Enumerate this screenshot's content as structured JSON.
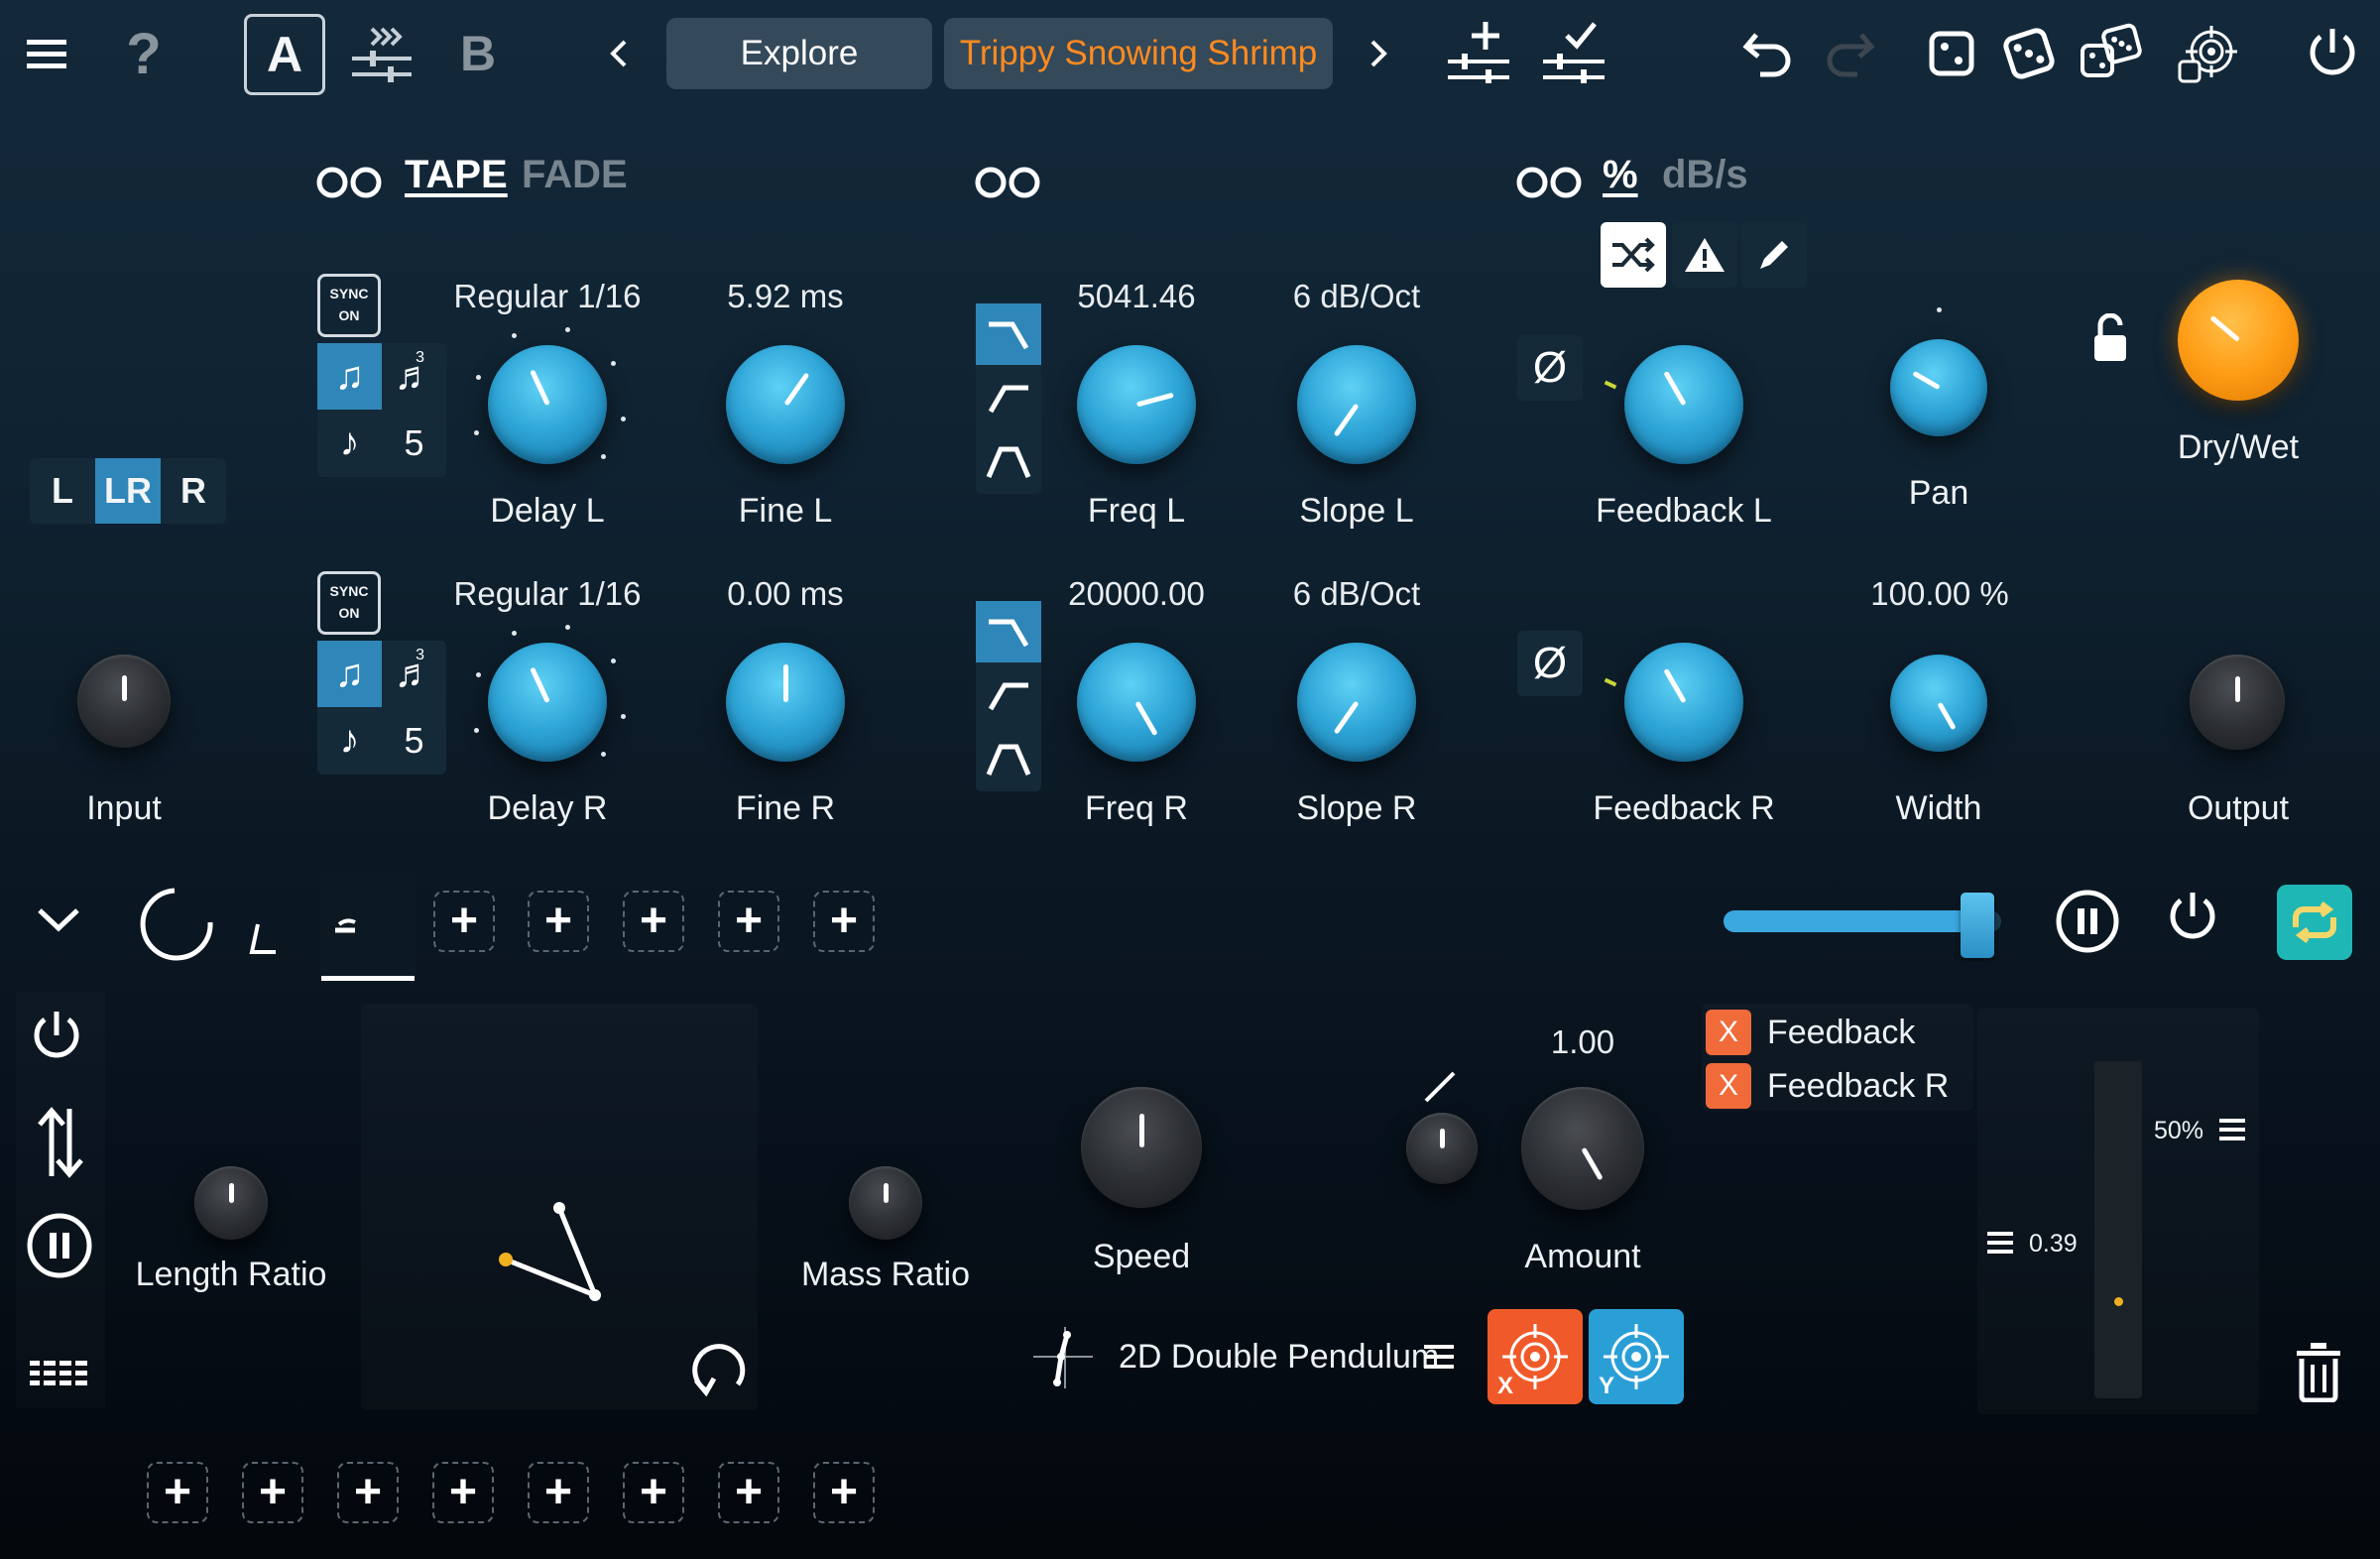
{
  "header": {
    "preset_a": "A",
    "preset_b": "B",
    "explore_label": "Explore",
    "preset_name": "Trippy Snowing Shrimp"
  },
  "delay_section": {
    "mode_tape": "TAPE",
    "mode_fade": "FADE",
    "stereo_modes": [
      "L",
      "LR",
      "R"
    ],
    "sync_label": "SYNC ON",
    "left": {
      "time_value": "Regular 1/16",
      "fine_value": "5.92 ms",
      "delay_label": "Delay L",
      "fine_label": "Fine L",
      "steps": "5"
    },
    "right": {
      "time_value": "Regular 1/16",
      "fine_value": "0.00 ms",
      "delay_label": "Delay R",
      "fine_label": "Fine R",
      "steps": "5"
    },
    "triplet_num": "3"
  },
  "filter_section": {
    "left": {
      "freq_value": "5041.46",
      "slope_value": "6 dB/Oct",
      "freq_label": "Freq L",
      "slope_label": "Slope L"
    },
    "right": {
      "freq_value": "20000.00",
      "slope_value": "6 dB/Oct",
      "freq_label": "Freq R",
      "slope_label": "Slope R"
    }
  },
  "feedback_section": {
    "unit_percent": "%",
    "unit_dbs": "dB/s",
    "phase_symbol": "Ø",
    "feedback_l_label": "Feedback L",
    "feedback_r_label": "Feedback R",
    "pan_label": "Pan",
    "width_value": "100.00 %",
    "width_label": "Width",
    "drywet_label": "Dry/Wet",
    "input_label": "Input",
    "output_label": "Output"
  },
  "modulator": {
    "length_ratio_label": "Length Ratio",
    "mass_ratio_label": "Mass Ratio",
    "speed_label": "Speed",
    "amount_value": "1.00",
    "amount_label": "Amount",
    "mod_type": "2D Double Pendulum",
    "target_x": "X",
    "target_y": "Y",
    "destinations": [
      {
        "remove": "X",
        "name": "Feedback"
      },
      {
        "remove": "X",
        "name": "Feedback R"
      }
    ],
    "meter_percent": "50%",
    "meter_value": "0.39",
    "slider_percent": 0.97
  },
  "colors": {
    "accent_blue": "#2f86b8",
    "knob_blue": "#2fa6d8",
    "accent_orange": "#ff8a1e",
    "remove_red": "#f06a3a",
    "target_blue": "#2a9fd6",
    "loop_teal": "#1fb7b5"
  },
  "icons": [
    "menu-icon",
    "help-icon",
    "copy-a-to-b-icon",
    "undo-icon",
    "redo-icon",
    "dice-icon",
    "power-icon",
    "shuffle-icon",
    "warning-icon",
    "pen-icon",
    "lock-icon",
    "pause-icon",
    "loop-icon",
    "trash-icon",
    "pendulum-icon"
  ]
}
